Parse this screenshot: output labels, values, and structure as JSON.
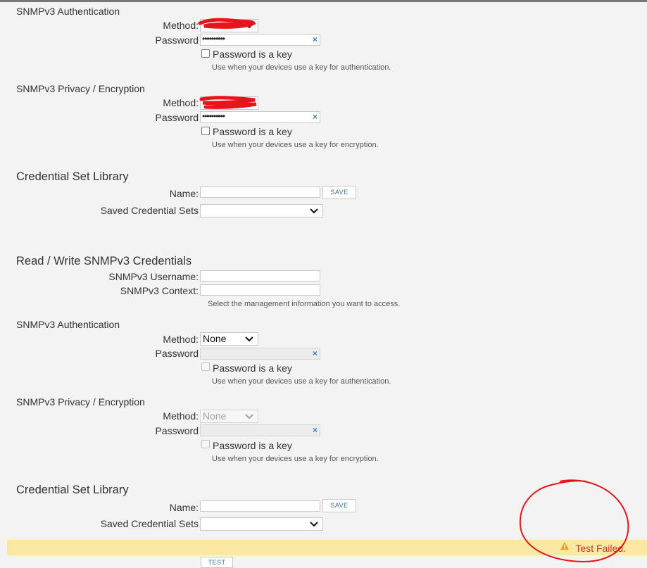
{
  "upper": {
    "auth": {
      "heading": "SNMPv3 Authentication",
      "method_label": "Method:",
      "password_label": "Password",
      "password_dots": "••••••••••",
      "clear_glyph": "×",
      "is_key_label": "Password is a key",
      "hint": "Use when your devices use a key for authentication."
    },
    "privacy": {
      "heading": "SNMPv3 Privacy / Encryption",
      "method_label": "Method:",
      "password_label": "Password",
      "password_dots": "••••••••••",
      "clear_glyph": "×",
      "is_key_label": "Password is a key",
      "hint": "Use when your devices use a key for encryption."
    },
    "library": {
      "heading": "Credential Set Library",
      "name_label": "Name:",
      "name_value": "",
      "save_label": "SAVE",
      "saved_label": "Saved Credential Sets",
      "saved_value": ""
    }
  },
  "rw": {
    "heading": "Read / Write SNMPv3 Credentials",
    "username_label": "SNMPv3 Username:",
    "username_value": "",
    "context_label": "SNMPv3 Context:",
    "context_value": "",
    "context_hint": "Select the management information you want to access.",
    "auth": {
      "heading": "SNMPv3 Authentication",
      "method_label": "Method:",
      "method_value": "None",
      "password_label": "Password",
      "clear_glyph": "×",
      "is_key_label": "Password is a key",
      "hint": "Use when your devices use a key for authentication."
    },
    "privacy": {
      "heading": "SNMPv3 Privacy / Encryption",
      "method_label": "Method:",
      "method_value": "None",
      "password_label": "Password",
      "clear_glyph": "×",
      "is_key_label": "Password is a key",
      "hint": "Use when your devices use a key for encryption."
    },
    "library": {
      "heading": "Credential Set Library",
      "name_label": "Name:",
      "name_value": "",
      "save_label": "SAVE",
      "saved_label": "Saved Credential Sets",
      "saved_value": ""
    }
  },
  "alert": {
    "message": "Test Failed.",
    "icon": "warning-icon"
  },
  "test_button_label": "TEST",
  "colors": {
    "alert_bg": "#fbe9a3",
    "alert_text": "#c0392b",
    "annotation": "#e8141b",
    "link": "#3a6f99"
  }
}
